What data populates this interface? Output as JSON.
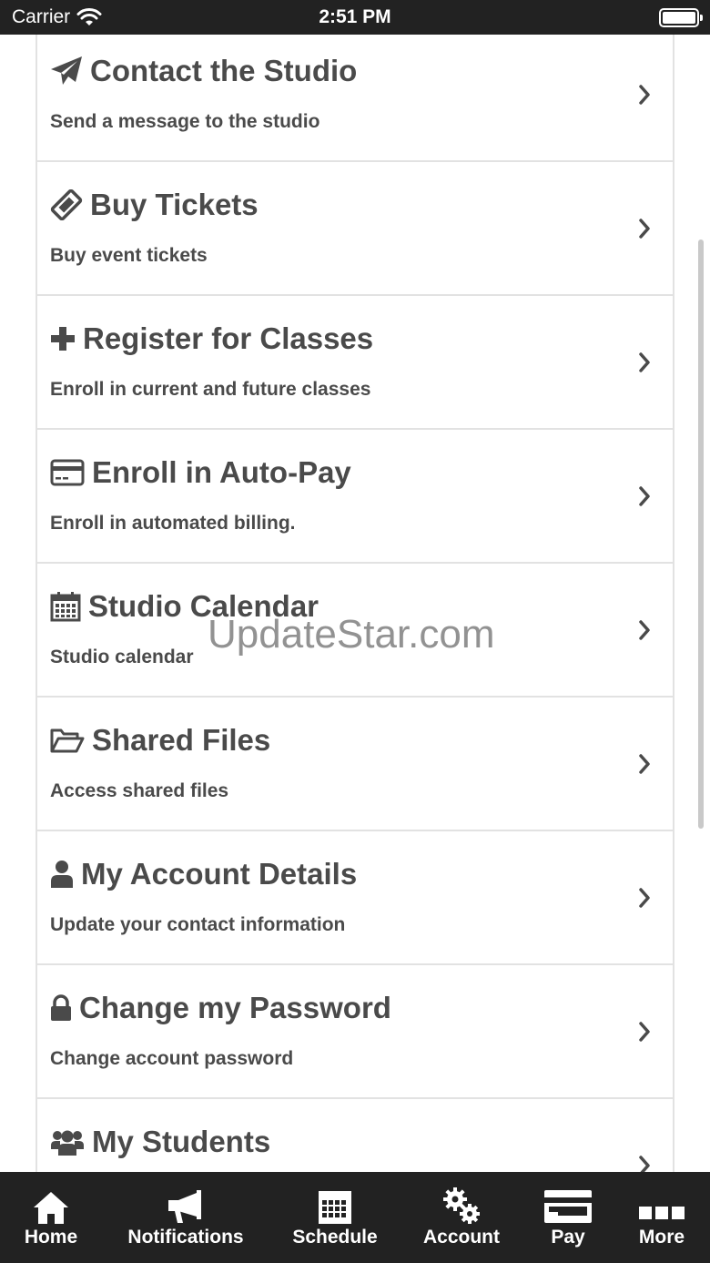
{
  "status_bar": {
    "carrier": "Carrier",
    "time": "2:51 PM"
  },
  "menu": [
    {
      "title": "Contact the Studio",
      "subtitle": "Send a message to the studio",
      "icon": "paper-plane-icon"
    },
    {
      "title": "Buy Tickets",
      "subtitle": "Buy event tickets",
      "icon": "ticket-icon"
    },
    {
      "title": "Register for Classes",
      "subtitle": "Enroll in current and future classes",
      "icon": "plus-icon"
    },
    {
      "title": "Enroll in Auto-Pay",
      "subtitle": "Enroll in automated billing.",
      "icon": "credit-card-icon"
    },
    {
      "title": "Studio Calendar",
      "subtitle": "Studio calendar",
      "icon": "calendar-icon"
    },
    {
      "title": "Shared Files",
      "subtitle": "Access shared files",
      "icon": "folder-open-icon"
    },
    {
      "title": "My Account Details",
      "subtitle": "Update your contact information",
      "icon": "user-icon"
    },
    {
      "title": "Change my Password",
      "subtitle": "Change account password",
      "icon": "lock-icon"
    },
    {
      "title": "My Students",
      "subtitle": "",
      "icon": "users-icon"
    }
  ],
  "watermark": "UpdateStar.com",
  "tabs": [
    {
      "label": "Home",
      "icon": "home-icon"
    },
    {
      "label": "Notifications",
      "icon": "bullhorn-icon"
    },
    {
      "label": "Schedule",
      "icon": "calendar-grid-icon"
    },
    {
      "label": "Account",
      "icon": "gears-icon"
    },
    {
      "label": "Pay",
      "icon": "card-icon"
    },
    {
      "label": "More",
      "icon": "more-dots-icon"
    }
  ],
  "colors": {
    "bar": "#222222",
    "text": "#4a4a4a",
    "divider": "#e2e2e2"
  }
}
